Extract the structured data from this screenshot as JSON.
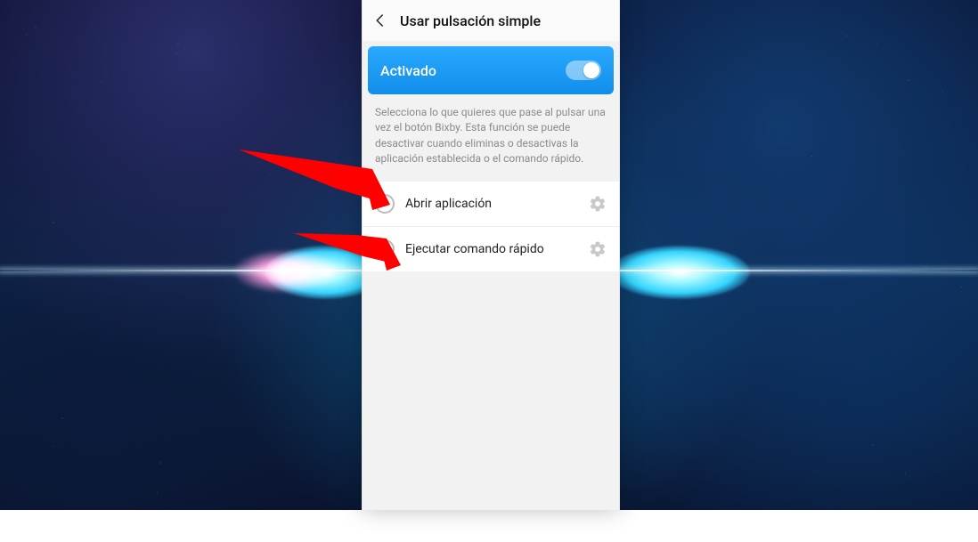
{
  "header": {
    "title": "Usar pulsación simple"
  },
  "toggle": {
    "label": "Activado",
    "on": true
  },
  "description": "Selecciona lo que quieres que pase al pulsar una vez el botón Bixby. Esta función se puede desactivar cuando eliminas o desactivas la aplicación establecida o el comando rápido.",
  "options": [
    {
      "label": "Abrir aplicación",
      "selected": false
    },
    {
      "label": "Ejecutar comando rápido",
      "selected": false
    }
  ],
  "colors": {
    "accent": "#1e9bff",
    "arrow": "#ff0000"
  }
}
